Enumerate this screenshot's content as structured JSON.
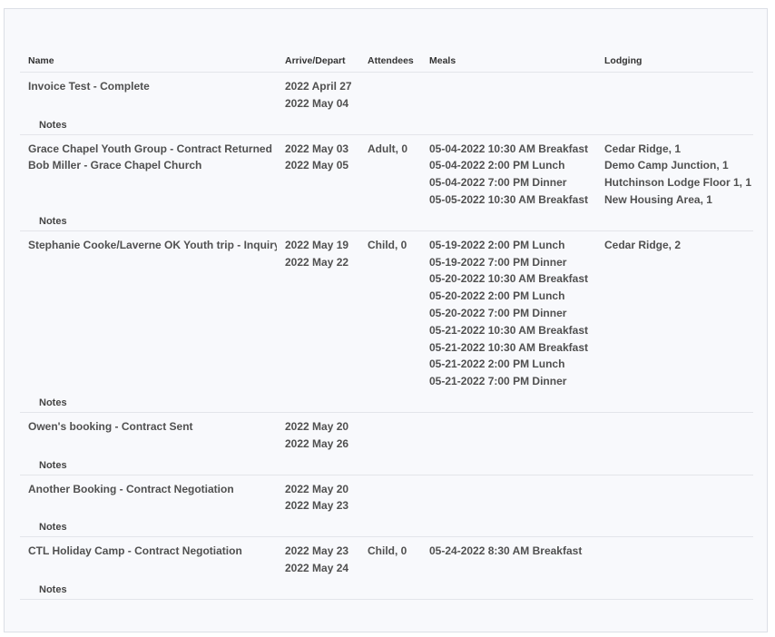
{
  "table": {
    "headers": {
      "name": "Name",
      "dates": "Arrive/Depart",
      "attendees": "Attendees",
      "meals": "Meals",
      "lodging": "Lodging"
    },
    "notes_label": "Notes",
    "rows": [
      {
        "name_line1": "Invoice Test - Complete",
        "name_line2": "",
        "arrive": "2022 April 27",
        "depart": "2022 May 04",
        "attendees": "",
        "meals": [],
        "lodging": []
      },
      {
        "name_line1": "Grace Chapel Youth Group - Contract Returned",
        "name_line2": "Bob Miller - Grace Chapel Church",
        "arrive": "2022 May 03",
        "depart": "2022 May 05",
        "attendees": "Adult, 0",
        "meals": [
          "05-04-2022 10:30 AM Breakfast",
          "05-04-2022 2:00 PM Lunch",
          "05-04-2022 7:00 PM Dinner",
          "05-05-2022 10:30 AM Breakfast"
        ],
        "lodging": [
          "Cedar Ridge, 1",
          "Demo Camp Junction, 1",
          "Hutchinson Lodge Floor 1, 1",
          "New Housing Area, 1"
        ]
      },
      {
        "name_line1": "Stephanie Cooke/Laverne OK Youth trip - Inquiry",
        "name_line2": "",
        "arrive": "2022 May 19",
        "depart": "2022 May 22",
        "attendees": "Child, 0",
        "meals": [
          "05-19-2022 2:00 PM Lunch",
          "05-19-2022 7:00 PM Dinner",
          "05-20-2022 10:30 AM Breakfast",
          "05-20-2022 2:00 PM Lunch",
          "05-20-2022 7:00 PM Dinner",
          "05-21-2022 10:30 AM Breakfast",
          "05-21-2022 10:30 AM Breakfast",
          "05-21-2022 2:00 PM Lunch",
          "05-21-2022 7:00 PM Dinner"
        ],
        "lodging": [
          "Cedar Ridge, 2"
        ]
      },
      {
        "name_line1": "Owen's booking - Contract Sent",
        "name_line2": "",
        "arrive": "2022 May 20",
        "depart": "2022 May 26",
        "attendees": "",
        "meals": [],
        "lodging": []
      },
      {
        "name_line1": "Another Booking - Contract Negotiation",
        "name_line2": "",
        "arrive": "2022 May 20",
        "depart": "2022 May 23",
        "attendees": "",
        "meals": [],
        "lodging": []
      },
      {
        "name_line1": "CTL Holiday Camp - Contract Negotiation",
        "name_line2": "",
        "arrive": "2022 May 23",
        "depart": "2022 May 24",
        "attendees": "Child, 0",
        "meals": [
          "05-24-2022 8:30 AM Breakfast"
        ],
        "lodging": []
      }
    ]
  }
}
